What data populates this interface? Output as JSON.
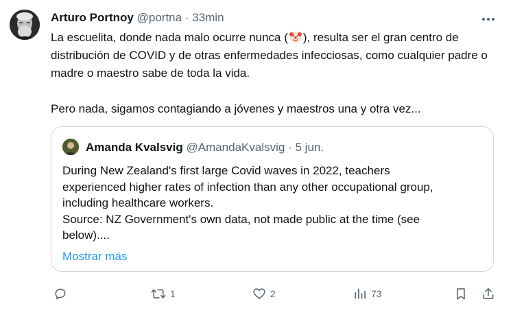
{
  "tweet": {
    "author_name": "Arturo Portnoy",
    "handle": "@portna",
    "separator": "·",
    "time": "33min",
    "text_p1_a": "La escuelita, donde nada malo ocurre nunca (",
    "text_p1_b": "), resulta ser el gran centro de distribución de COVID y de otras enfermedades infecciosas, como cualquier padre o madre o maestro sabe de toda la vida.",
    "text_p2": "Pero nada, sigamos contagiando a jóvenes y maestros una y otra vez...",
    "clown_emoji_icon": "clown-face-icon"
  },
  "quote": {
    "author_name": "Amanda Kvalsvig",
    "handle": "@AmandaKvalsvig",
    "separator": "·",
    "date": "5 jun.",
    "lines": [
      "During New Zealand's first large Covid waves in 2022, teachers",
      "experienced higher rates of infection than any other occupational group,",
      "including healthcare workers.",
      "Source: NZ Government's own data, not made public at the time (see",
      "below)...."
    ],
    "show_more_label": "Mostrar más"
  },
  "actions": {
    "reply_count": "",
    "retweet_count": "1",
    "like_count": "2",
    "views_count": "73"
  },
  "colors": {
    "text": "#0f1419",
    "muted": "#536471",
    "link": "#1d9bf0",
    "border": "#cfd9de"
  }
}
